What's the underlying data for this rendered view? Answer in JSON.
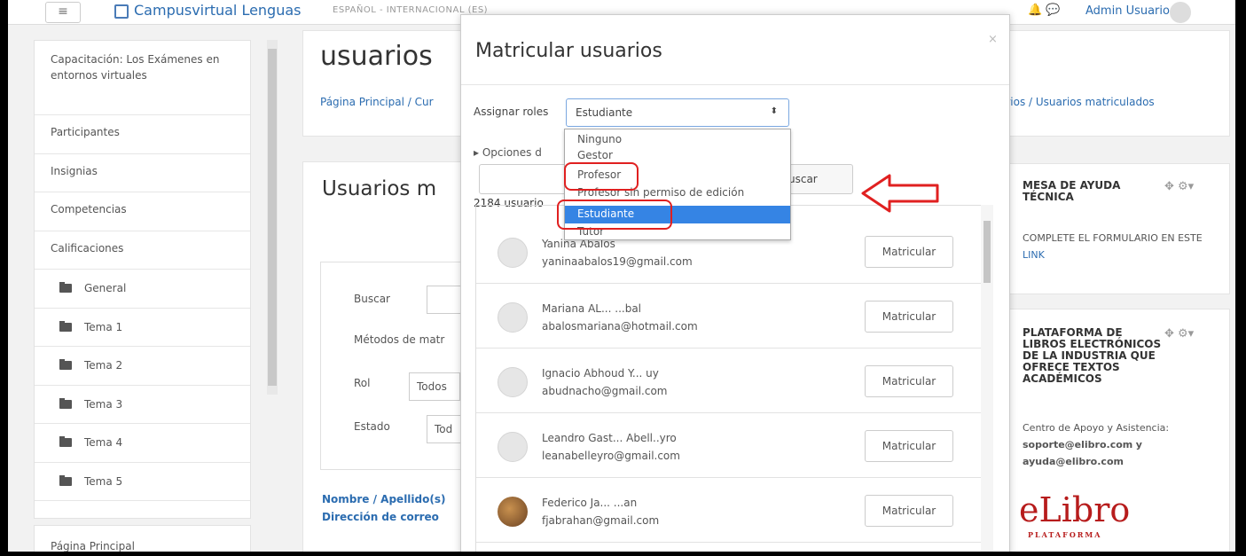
{
  "navbar": {
    "menu_icon": "hamburger-icon",
    "brand": "Campusvirtual Lenguas",
    "language": "ESPAÑOL - INTERNACIONAL (ES)",
    "user": "Admin Usuario"
  },
  "sidebar": {
    "items": [
      {
        "label": "Capacitación: Los Exámenes en entornos virtuales"
      },
      {
        "label": "Participantes"
      },
      {
        "label": "Insignias"
      },
      {
        "label": "Competencias"
      },
      {
        "label": "Calificaciones"
      },
      {
        "label": "General"
      },
      {
        "label": "Tema 1"
      },
      {
        "label": "Tema 2"
      },
      {
        "label": "Tema 3"
      },
      {
        "label": "Tema 4"
      },
      {
        "label": "Tema 5"
      }
    ],
    "home": "Página Principal"
  },
  "main": {
    "title": "usuarios",
    "breadcrumb_start": "Página Principal / Cur",
    "breadcrumb_end": "arios / Usuarios matriculados",
    "section_title": "Usuarios m",
    "filters": {
      "search_label": "Buscar",
      "methods_label": "Métodos de matr",
      "role_label": "Rol",
      "role_value": "Todos",
      "state_label": "Estado",
      "state_value": "Tod"
    },
    "sort_name": "Nombre / Apellido(s)",
    "sort_email": "Dirección de correo"
  },
  "modal": {
    "title": "Matricular usuarios",
    "assign_roles_label": "Assignar roles",
    "selected_role": "Estudiante",
    "options_label": "Opciones d",
    "search_button": "uscar",
    "user_count": "2184 usuario",
    "role_options": [
      "Ninguno",
      "Gestor",
      "Profesor",
      "Profesor sin permiso de edición",
      "Estudiante",
      "Tutor"
    ],
    "highlighted_options": [
      "Profesor",
      "Estudiante"
    ],
    "users": [
      {
        "name": "Yanina Abalos",
        "email": "yaninaabalos19@gmail.com",
        "button": "Matricular"
      },
      {
        "name": "Mariana AL... ...bal",
        "email": "abalosmariana@hotmail.com",
        "button": "Matricular"
      },
      {
        "name": "Ignacio Abhoud Y... uy",
        "email": "abudnacho@gmail.com",
        "button": "Matricular"
      },
      {
        "name": "Leandro Gast... Abell..yro",
        "email": "leanabelleyro@gmail.com",
        "button": "Matricular"
      },
      {
        "name": "Federico Ja... ...an",
        "email": "fjabrahan@gmail.com",
        "button": "Matricular"
      }
    ]
  },
  "blocks": {
    "help_title": "MESA DE AYUDA TÉCNICA",
    "help_text": "COMPLETE EL FORMULARIO EN ESTE",
    "help_link": "LINK",
    "books_title": "PLATAFORMA DE LIBROS ELECTRÓNICOS DE LA INDUSTRIA QUE OFRECE TEXTOS ACADÉMICOS",
    "support_text": "Centro de Apoyo y Asistencia:",
    "support_email1": "soporte@elibro.com",
    "support_and": "y",
    "support_email2": "ayuda@elibro.com",
    "logo": "eLibro",
    "logo_sub": "PLATAFORMA"
  },
  "colors": {
    "link": "#2b6cb0",
    "highlight": "#e02020",
    "selected_option": "#3584e4"
  }
}
